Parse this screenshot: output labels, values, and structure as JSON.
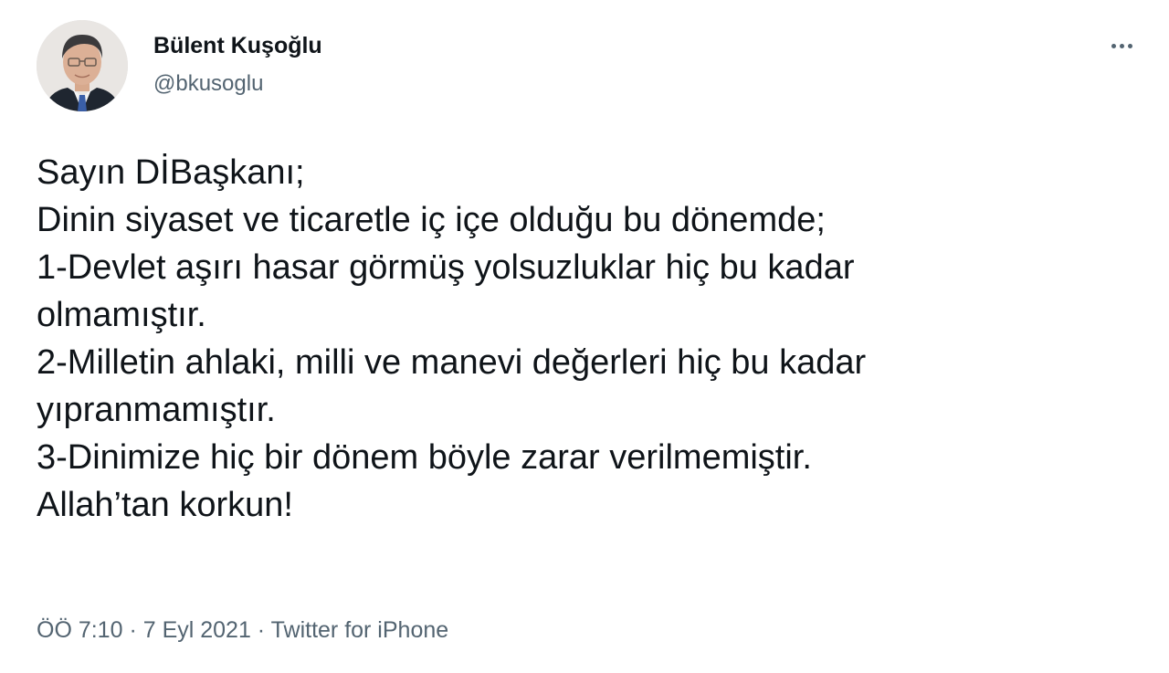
{
  "author": {
    "display_name": "Bülent Kuşoğlu",
    "handle": "@bkusoglu"
  },
  "tweet": {
    "lines": [
      "Sayın DİBaşkanı;",
      "Dinin siyaset ve ticaretle iç içe olduğu bu dönemde;",
      "1-Devlet aşırı hasar görmüş yolsuzluklar hiç bu kadar",
      "olmamıştır.",
      "2-Milletin ahlaki, milli ve manevi değerleri hiç bu kadar",
      "yıpranmamıştır.",
      "3-Dinimize hiç bir dönem böyle zarar verilmemiştir.",
      "Allah’tan korkun!"
    ]
  },
  "meta": {
    "time": "ÖÖ 7:10",
    "separator1": " · ",
    "date": "7 Eyl 2021",
    "separator2": " · ",
    "source": "Twitter for iPhone"
  },
  "icons": {
    "more": "more-horizontal-icon"
  },
  "colors": {
    "text_primary": "#0f1419",
    "text_secondary": "#536471",
    "background": "#ffffff"
  }
}
